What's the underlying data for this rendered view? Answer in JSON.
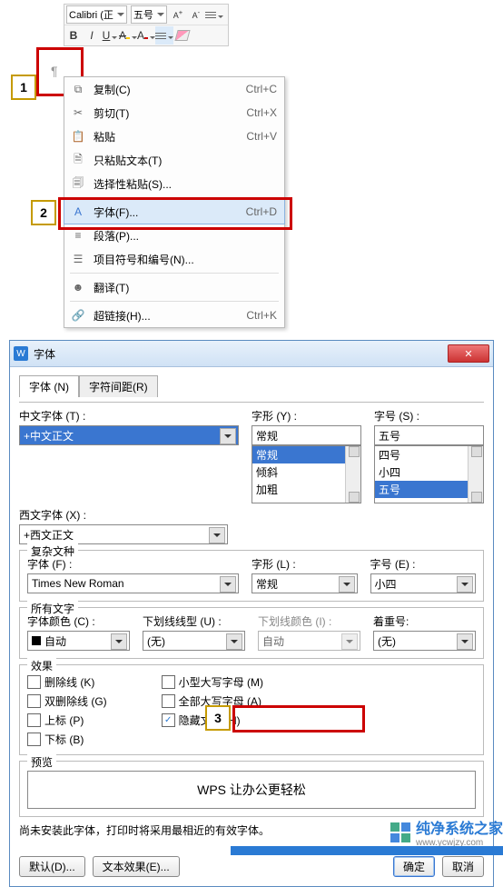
{
  "toolbar": {
    "font_name": "Calibri (正",
    "font_size": "五号"
  },
  "markers": {
    "m1": "1",
    "m2": "2",
    "m3": "3"
  },
  "ctx": {
    "copy": {
      "label": "复制(C)",
      "shortcut": "Ctrl+C"
    },
    "cut": {
      "label": "剪切(T)",
      "shortcut": "Ctrl+X"
    },
    "paste": {
      "label": "粘贴",
      "shortcut": "Ctrl+V"
    },
    "paste_text": {
      "label": "只粘贴文本(T)"
    },
    "paste_special": {
      "label": "选择性粘贴(S)..."
    },
    "font": {
      "label": "字体(F)...",
      "shortcut": "Ctrl+D"
    },
    "paragraph": {
      "label": "段落(P)..."
    },
    "bullets": {
      "label": "项目符号和编号(N)..."
    },
    "translate": {
      "label": "翻译(T)"
    },
    "hyperlink": {
      "label": "超链接(H)...",
      "shortcut": "Ctrl+K"
    }
  },
  "dialog": {
    "title": "字体",
    "tabs": {
      "font": "字体 (N)",
      "spacing": "字符间距(R)"
    },
    "labels": {
      "cn_font": "中文字体 (T) :",
      "style": "字形 (Y) :",
      "size": "字号 (S) :",
      "wn_font": "西文字体 (X) :",
      "complex": "复杂文种",
      "font_p": "字体 (F) :",
      "style_l": "字形 (L) :",
      "size_e": "字号 (E) :",
      "all_text": "所有文字",
      "font_color": "字体颜色 (C) :",
      "underline": "下划线线型 (U) :",
      "underline_color": "下划线颜色 (I) :",
      "emphasis": "着重号:",
      "effects": "效果",
      "preview": "预览"
    },
    "values": {
      "cn_font": "+中文正文",
      "style": "常规",
      "size": "五号",
      "wn_font": "+西文正文",
      "style_list": [
        "常规",
        "倾斜",
        "加粗"
      ],
      "size_list": [
        "四号",
        "小四",
        "五号"
      ],
      "complex_font": "Times New Roman",
      "complex_style": "常规",
      "complex_size": "小四",
      "auto": "自动",
      "none": "(无)"
    },
    "checks": {
      "strike": "删除线 (K)",
      "dstrike": "双删除线 (G)",
      "super": "上标 (P)",
      "sub": "下标 (B)",
      "smallcaps": "小型大写字母 (M)",
      "allcaps": "全部大写字母 (A)",
      "hidden": "隐藏文字 (H)"
    },
    "preview_text": "WPS 让办公更轻松",
    "note": "尚未安装此字体，打印时将采用最相近的有效字体。",
    "buttons": {
      "default": "默认(D)...",
      "text_effect": "文本效果(E)...",
      "ok": "确定",
      "cancel": "取消"
    }
  },
  "watermark": {
    "cn": "纯净系统之家",
    "en": "www.ycwjzy.com"
  }
}
